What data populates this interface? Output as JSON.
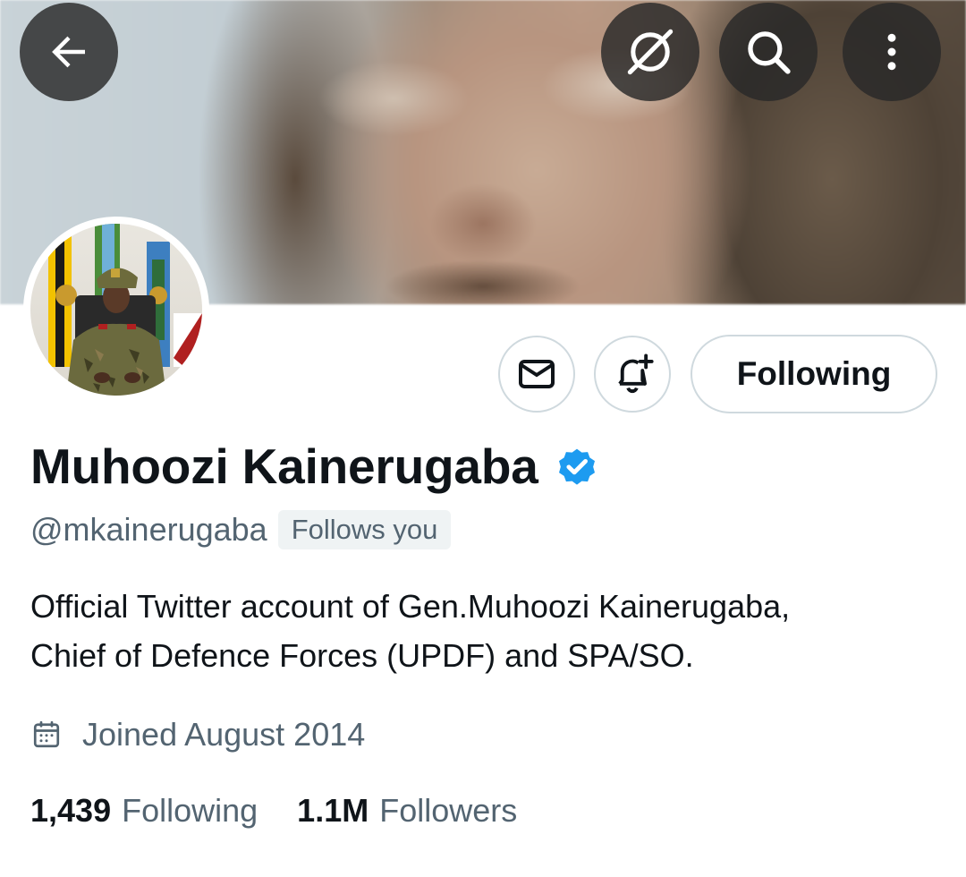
{
  "profile": {
    "display_name": "Muhoozi Kainerugaba",
    "handle": "@mkainerugaba",
    "follows_you_badge": "Follows you",
    "bio_line1": "Official Twitter account of Gen.Muhoozi Kainerugaba,",
    "bio_line2": "Chief of Defence Forces (UPDF) and SPA/SO.",
    "joined": "Joined August 2014",
    "verified": true
  },
  "stats": {
    "following_count": "1,439",
    "following_label": "Following",
    "followers_count": "1.1M",
    "followers_label": "Followers"
  },
  "actions": {
    "following_button": "Following"
  },
  "icons": {
    "back": "arrow-left-icon",
    "translate": "no-translate-icon",
    "search": "search-icon",
    "more": "more-vertical-icon",
    "message": "envelope-icon",
    "notifications": "bell-plus-icon",
    "verified": "verified-badge-icon",
    "calendar": "calendar-icon"
  },
  "colors": {
    "verified_blue": "#1d9bf0",
    "text_primary": "#0f1419",
    "text_secondary": "#536471",
    "border": "#cfd9de",
    "badge_bg": "#eff3f4"
  }
}
